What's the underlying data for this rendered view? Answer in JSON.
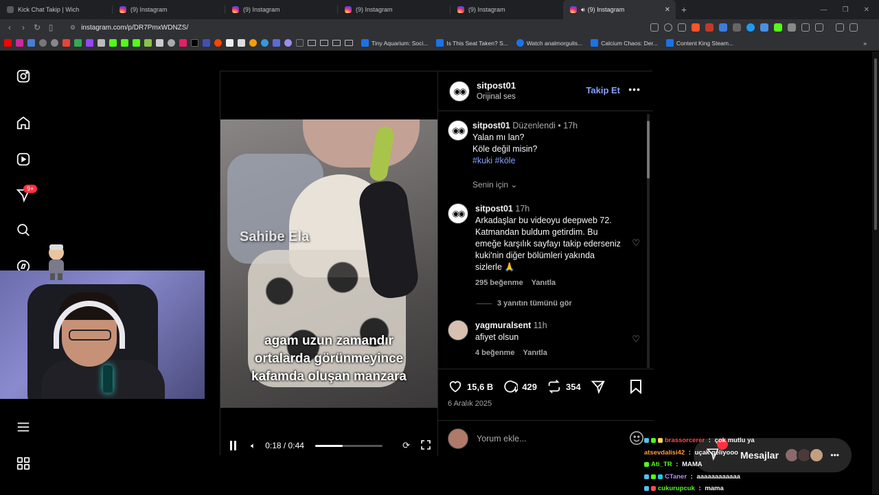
{
  "browser": {
    "tabs": [
      {
        "title": "Kick Chat Takip | Wich",
        "kind": "kick",
        "active": false
      },
      {
        "title": "(9) Instagram",
        "kind": "ig",
        "active": false
      },
      {
        "title": "(9) Instagram",
        "kind": "ig",
        "active": false
      },
      {
        "title": "(9) Instagram",
        "kind": "ig",
        "active": false
      },
      {
        "title": "(9) Instagram",
        "kind": "ig",
        "active": false
      },
      {
        "title": "(9) Instagram",
        "kind": "ig",
        "active": true
      }
    ],
    "url": "instagram.com/p/DR7PmxWDNZS/",
    "bookmarks": [
      {
        "label": "Tiny Aquarium: Soci..."
      },
      {
        "label": "Is This Seat Taken? S..."
      },
      {
        "label": "Watch analmorgulis..."
      },
      {
        "label": "Calcium Chaos: Der..."
      },
      {
        "label": "Content King Steam..."
      }
    ]
  },
  "sidenav": {
    "badge": "9+"
  },
  "post": {
    "video": {
      "watermark": "Sahibe Ela",
      "caption_lines": [
        "agam uzun zamandır",
        "ortalarda görünmeyince",
        "kafamda oluşan manzara"
      ],
      "time": "0:18 / 0:44",
      "progress": 0.41
    },
    "header": {
      "username": "sitpost01",
      "audio": "Orijinal ses",
      "follow_label": "Takip Et"
    },
    "caption": {
      "username": "sitpost01",
      "edited": "Düzenlendi",
      "dot": "•",
      "time": "17h",
      "lines": [
        "Yalan mı lan?",
        "Köle değil misin?"
      ],
      "tags": "#kuki #köle",
      "translation": "Senin için"
    },
    "comments": [
      {
        "username": "sitpost01",
        "time": "17h",
        "text": "Arkadaşlar bu videoyu deepweb 72. Katmandan buldum getirdim. Bu emeğe karşılık sayfayı takip ederseniz kuki'nin diğer bölümleri yakında sizlerle 🙏",
        "likes": "295 beğenme",
        "reply": "Yanıtla"
      },
      {
        "username": "yagmuralsent",
        "time": "11h",
        "text": "afiyet olsun",
        "likes": "4 beğenme",
        "reply": "Yanıtla"
      }
    ],
    "view_replies": "3 yanıtın tümünü gör",
    "stats": {
      "likes": "15,6 B",
      "comments": "429",
      "reposts": "354"
    },
    "date": "6 Aralık 2025",
    "comment_placeholder": "Yorum ekle..."
  },
  "chat": [
    {
      "user": "brassorcerer",
      "msg": "çok mutlu ya",
      "color": "#ff4d4d"
    },
    {
      "user": "atsevdalisi42",
      "msg": "uçak geliyooo",
      "color": "#ff9a3c"
    },
    {
      "user": "Ati_TR",
      "msg": "MAMA",
      "color": "#53fc18"
    },
    {
      "user": "CTaner",
      "msg": "aaaaaaaaaaaa",
      "color": "#b48cff"
    },
    {
      "user": "cukurupcuk",
      "msg": "mama",
      "color": "#53fc18"
    }
  ],
  "messages": {
    "label": "Mesajlar"
  }
}
